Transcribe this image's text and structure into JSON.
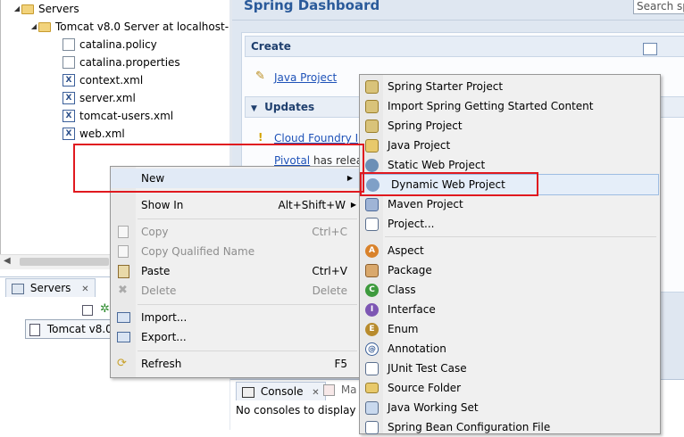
{
  "tree": {
    "root_label": "Servers",
    "server_label": "Tomcat v8.0 Server at localhost-",
    "files": [
      "catalina.policy",
      "catalina.properties",
      "context.xml",
      "server.xml",
      "tomcat-users.xml",
      "web.xml"
    ]
  },
  "dashboard": {
    "title": "Spring Dashboard",
    "search_placeholder": "Search sp",
    "create_label": "Create",
    "java_project_link": "Java Project",
    "updates_label": "Updates",
    "cloud_foundry_link": "Cloud Foundry I",
    "pivotal_link": "Pivotal",
    "pivotal_text": " has relea"
  },
  "servers_view": {
    "tab_label": "Servers",
    "server_item": "Tomcat v8.0"
  },
  "console_view": {
    "tab_label": "Console",
    "tab2_label": "Ma",
    "message": "No consoles to display"
  },
  "context_menu": {
    "items": [
      {
        "label": "New",
        "accel": "",
        "submenu": true,
        "disabled": false,
        "icon": ""
      },
      {
        "label": "Show In",
        "accel": "Alt+Shift+W",
        "submenu": true,
        "disabled": false,
        "icon": ""
      },
      {
        "label": "Copy",
        "accel": "Ctrl+C",
        "disabled": true,
        "icon": "copy-icon"
      },
      {
        "label": "Copy Qualified Name",
        "accel": "",
        "disabled": true,
        "icon": "copy-icon"
      },
      {
        "label": "Paste",
        "accel": "Ctrl+V",
        "disabled": false,
        "icon": "paste-icon"
      },
      {
        "label": "Delete",
        "accel": "Delete",
        "disabled": true,
        "icon": "delete-icon"
      },
      {
        "label": "Import...",
        "accel": "",
        "disabled": false,
        "icon": "import-icon"
      },
      {
        "label": "Export...",
        "accel": "",
        "disabled": false,
        "icon": "export-icon"
      },
      {
        "label": "Refresh",
        "accel": "F5",
        "disabled": false,
        "icon": "refresh-icon"
      }
    ]
  },
  "new_submenu": {
    "items": [
      {
        "label": "Spring Starter Project",
        "icon": "spring-starter-icon"
      },
      {
        "label": "Import Spring Getting Started Content",
        "icon": "spring-import-icon"
      },
      {
        "label": "Spring Project",
        "icon": "spring-project-icon"
      },
      {
        "label": "Java Project",
        "icon": "java-project-icon"
      },
      {
        "label": "Static Web Project",
        "icon": "static-web-icon"
      },
      {
        "label": "Dynamic Web Project",
        "icon": "dynamic-web-icon"
      },
      {
        "label": "Maven Project",
        "icon": "maven-project-icon"
      },
      {
        "label": "Project...",
        "icon": "project-icon"
      },
      {
        "label": "Aspect",
        "icon": "aspect-icon"
      },
      {
        "label": "Package",
        "icon": "package-icon"
      },
      {
        "label": "Class",
        "icon": "class-icon"
      },
      {
        "label": "Interface",
        "icon": "interface-icon"
      },
      {
        "label": "Enum",
        "icon": "enum-icon"
      },
      {
        "label": "Annotation",
        "icon": "annotation-icon"
      },
      {
        "label": "JUnit Test Case",
        "icon": "junit-icon"
      },
      {
        "label": "Source Folder",
        "icon": "source-folder-icon"
      },
      {
        "label": "Java Working Set",
        "icon": "working-set-icon"
      },
      {
        "label": "Spring Bean Configuration File",
        "icon": "spring-bean-icon"
      }
    ]
  },
  "colors": {
    "highlight_red": "#e0191f",
    "link_blue": "#1e52b8",
    "title_blue": "#2a5a9a"
  }
}
